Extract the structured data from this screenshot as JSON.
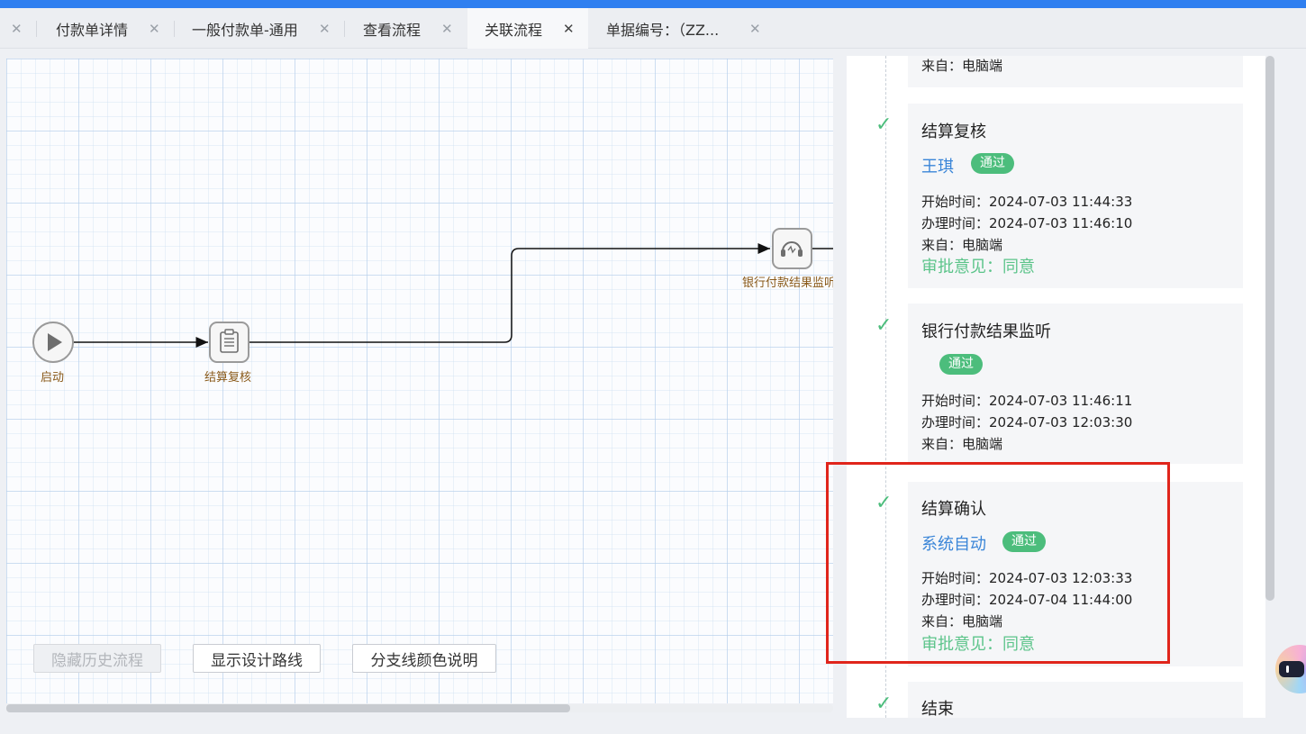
{
  "tabs": [
    {
      "label": "付款单详情"
    },
    {
      "label": "一般付款单-通用"
    },
    {
      "label": "查看流程"
    },
    {
      "label": "关联流程"
    },
    {
      "label": "单据编号：（ZZ..."
    }
  ],
  "tab_close_glyph": "✕",
  "flow_nodes": {
    "start": "启动",
    "review": "结算复核",
    "bank": "银行付款结果监听"
  },
  "canvas_buttons": {
    "hide_history": "隐藏历史流程",
    "show_design": "显示设计路线",
    "branch_color": "分支线颜色说明"
  },
  "timeline": {
    "partial_top": {
      "from": "来自：电脑端"
    },
    "items": [
      {
        "title": "结算复核",
        "user": "王琪",
        "badge": "通过",
        "start": "开始时间：2024-07-03 11:44:33",
        "handle": "办理时间：2024-07-03 11:46:10",
        "from": "来自：电脑端",
        "opinion": "审批意见：同意"
      },
      {
        "title": "银行付款结果监听",
        "user": "",
        "badge": "通过",
        "start": "开始时间：2024-07-03 11:46:11",
        "handle": "办理时间：2024-07-03 12:03:30",
        "from": "来自：电脑端"
      },
      {
        "title": "结算确认",
        "user": "系统自动",
        "badge": "通过",
        "start": "开始时间：2024-07-03 12:03:33",
        "handle": "办理时间：2024-07-04 11:44:00",
        "from": "来自：电脑端",
        "opinion": "审批意见：同意"
      },
      {
        "title": "结束"
      }
    ]
  },
  "colors": {
    "accent": "#2f7ff0",
    "pass_green": "#4cbd7c",
    "user_blue": "#3b86d8",
    "highlight_red": "#e0251b"
  },
  "icons": [
    "close-icon",
    "play-icon",
    "document-icon",
    "headset-icon",
    "check-icon"
  ]
}
